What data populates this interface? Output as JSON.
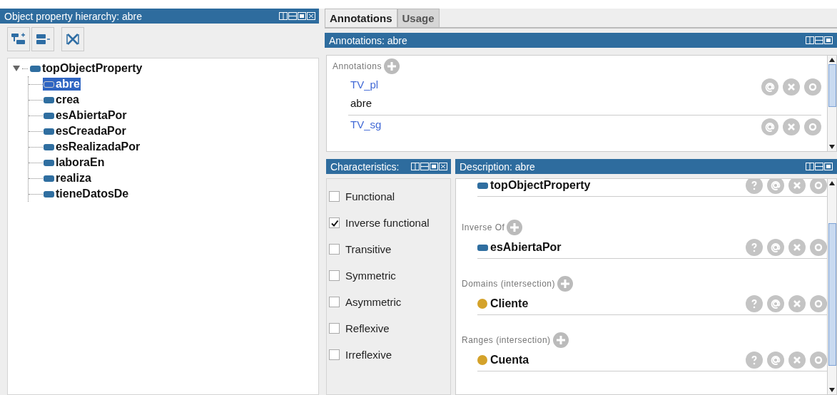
{
  "hierarchy_panel": {
    "title": "Object property hierarchy: abre",
    "tree": [
      {
        "label": "topObjectProperty",
        "expanded": true,
        "selected": false,
        "children": [
          {
            "label": "abre",
            "selected": true
          },
          {
            "label": "crea",
            "selected": false
          },
          {
            "label": "esAbiertaPor",
            "selected": false
          },
          {
            "label": "esCreadaPor",
            "selected": false
          },
          {
            "label": "esRealizadaPor",
            "selected": false
          },
          {
            "label": "laboraEn",
            "selected": false
          },
          {
            "label": "realiza",
            "selected": false
          },
          {
            "label": "tieneDatosDe",
            "selected": false
          }
        ]
      }
    ]
  },
  "tabs": [
    {
      "label": "Annotations",
      "selected": true
    },
    {
      "label": "Usage",
      "selected": false
    }
  ],
  "annotations_panel": {
    "title": "Annotations: abre",
    "header": "Annotations",
    "items": [
      {
        "property": "TV_pl",
        "value": "abre"
      },
      {
        "property": "TV_sg"
      }
    ]
  },
  "characteristics_panel": {
    "title": "Characteristics:",
    "items": [
      {
        "label": "Functional",
        "checked": false
      },
      {
        "label": "Inverse functional",
        "checked": true
      },
      {
        "label": "Transitive",
        "checked": false
      },
      {
        "label": "Symmetric",
        "checked": false
      },
      {
        "label": "Asymmetric",
        "checked": false
      },
      {
        "label": "Reflexive",
        "checked": false
      },
      {
        "label": "Irreflexive",
        "checked": false
      }
    ]
  },
  "description_panel": {
    "title": "Description: abre",
    "sections": [
      {
        "items": [
          {
            "name": "topObjectProperty",
            "kind": "property"
          }
        ]
      },
      {
        "label": "Inverse Of",
        "items": [
          {
            "name": "esAbiertaPor",
            "kind": "property"
          }
        ]
      },
      {
        "label": "Domains (intersection)",
        "items": [
          {
            "name": "Cliente",
            "kind": "class"
          }
        ]
      },
      {
        "label": "Ranges (intersection)",
        "items": [
          {
            "name": "Cuenta",
            "kind": "class"
          }
        ]
      }
    ]
  }
}
